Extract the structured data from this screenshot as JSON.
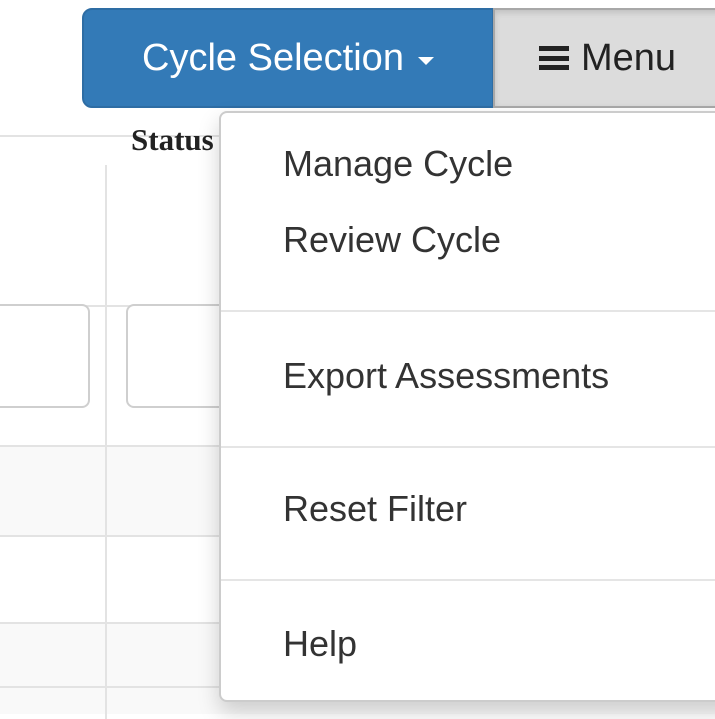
{
  "toolbar": {
    "cycle_selection_label": "Cycle Selection",
    "menu_label": "Menu",
    "accent_color": "#337ab7"
  },
  "table": {
    "header_status": "Status"
  },
  "dropdown": {
    "items": [
      {
        "label": "Manage Cycle"
      },
      {
        "label": "Review Cycle"
      },
      {
        "label": "Export Assessments"
      },
      {
        "label": "Reset Filter"
      },
      {
        "label": "Help"
      }
    ]
  },
  "icons": {
    "caret": "caret-down-icon",
    "menu": "hamburger-icon"
  }
}
